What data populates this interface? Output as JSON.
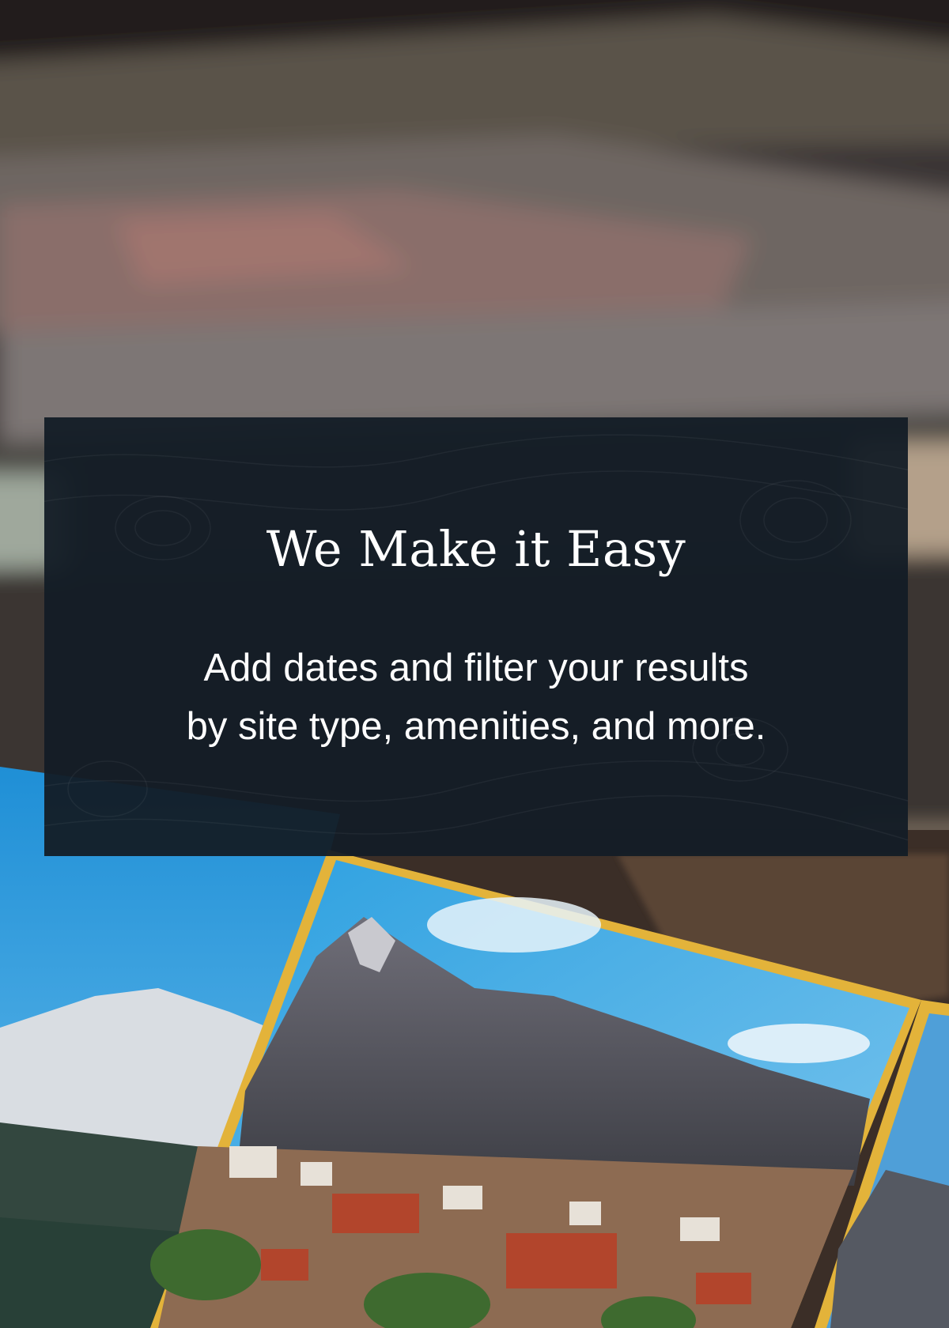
{
  "promo": {
    "title": "We Make it Easy",
    "body_line1": "Add dates and filter your results",
    "body_line2": "by site type, amenities, and more."
  },
  "background": {
    "icon": "postcards-photo",
    "description_colors": {
      "sky": "#2f9ad8",
      "postcard_border": "#e3b33a",
      "card_bg": "#131c26"
    }
  }
}
